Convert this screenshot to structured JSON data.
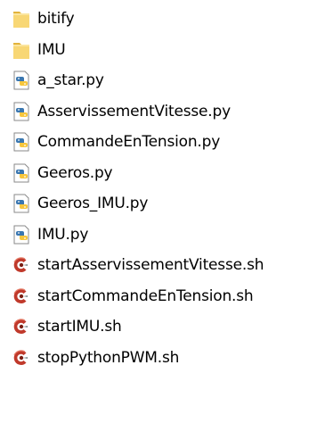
{
  "explorer": {
    "items": [
      {
        "name": "bitify",
        "type": "folder",
        "icon": "folder-icon"
      },
      {
        "name": "IMU",
        "type": "folder",
        "icon": "folder-icon"
      },
      {
        "name": "a_star.py",
        "type": "python",
        "icon": "python-file-icon"
      },
      {
        "name": "AsservissementVitesse.py",
        "type": "python",
        "icon": "python-file-icon"
      },
      {
        "name": "CommandeEnTension.py",
        "type": "python",
        "icon": "python-file-icon"
      },
      {
        "name": "Geeros.py",
        "type": "python",
        "icon": "python-file-icon"
      },
      {
        "name": "Geeros_IMU.py",
        "type": "python",
        "icon": "python-file-icon"
      },
      {
        "name": "IMU.py",
        "type": "python",
        "icon": "python-file-icon"
      },
      {
        "name": "startAsservissementVitesse.sh",
        "type": "shell",
        "icon": "shell-script-icon"
      },
      {
        "name": "startCommandeEnTension.sh",
        "type": "shell",
        "icon": "shell-script-icon"
      },
      {
        "name": "startIMU.sh",
        "type": "shell",
        "icon": "shell-script-icon"
      },
      {
        "name": "stopPythonPWM.sh",
        "type": "shell",
        "icon": "shell-script-icon"
      }
    ]
  },
  "colors": {
    "folder": "#f8d775",
    "folder_dark": "#e2b33c",
    "python_blue": "#3a77b0",
    "python_yellow": "#f7c63c",
    "shell_red": "#c0392b"
  }
}
